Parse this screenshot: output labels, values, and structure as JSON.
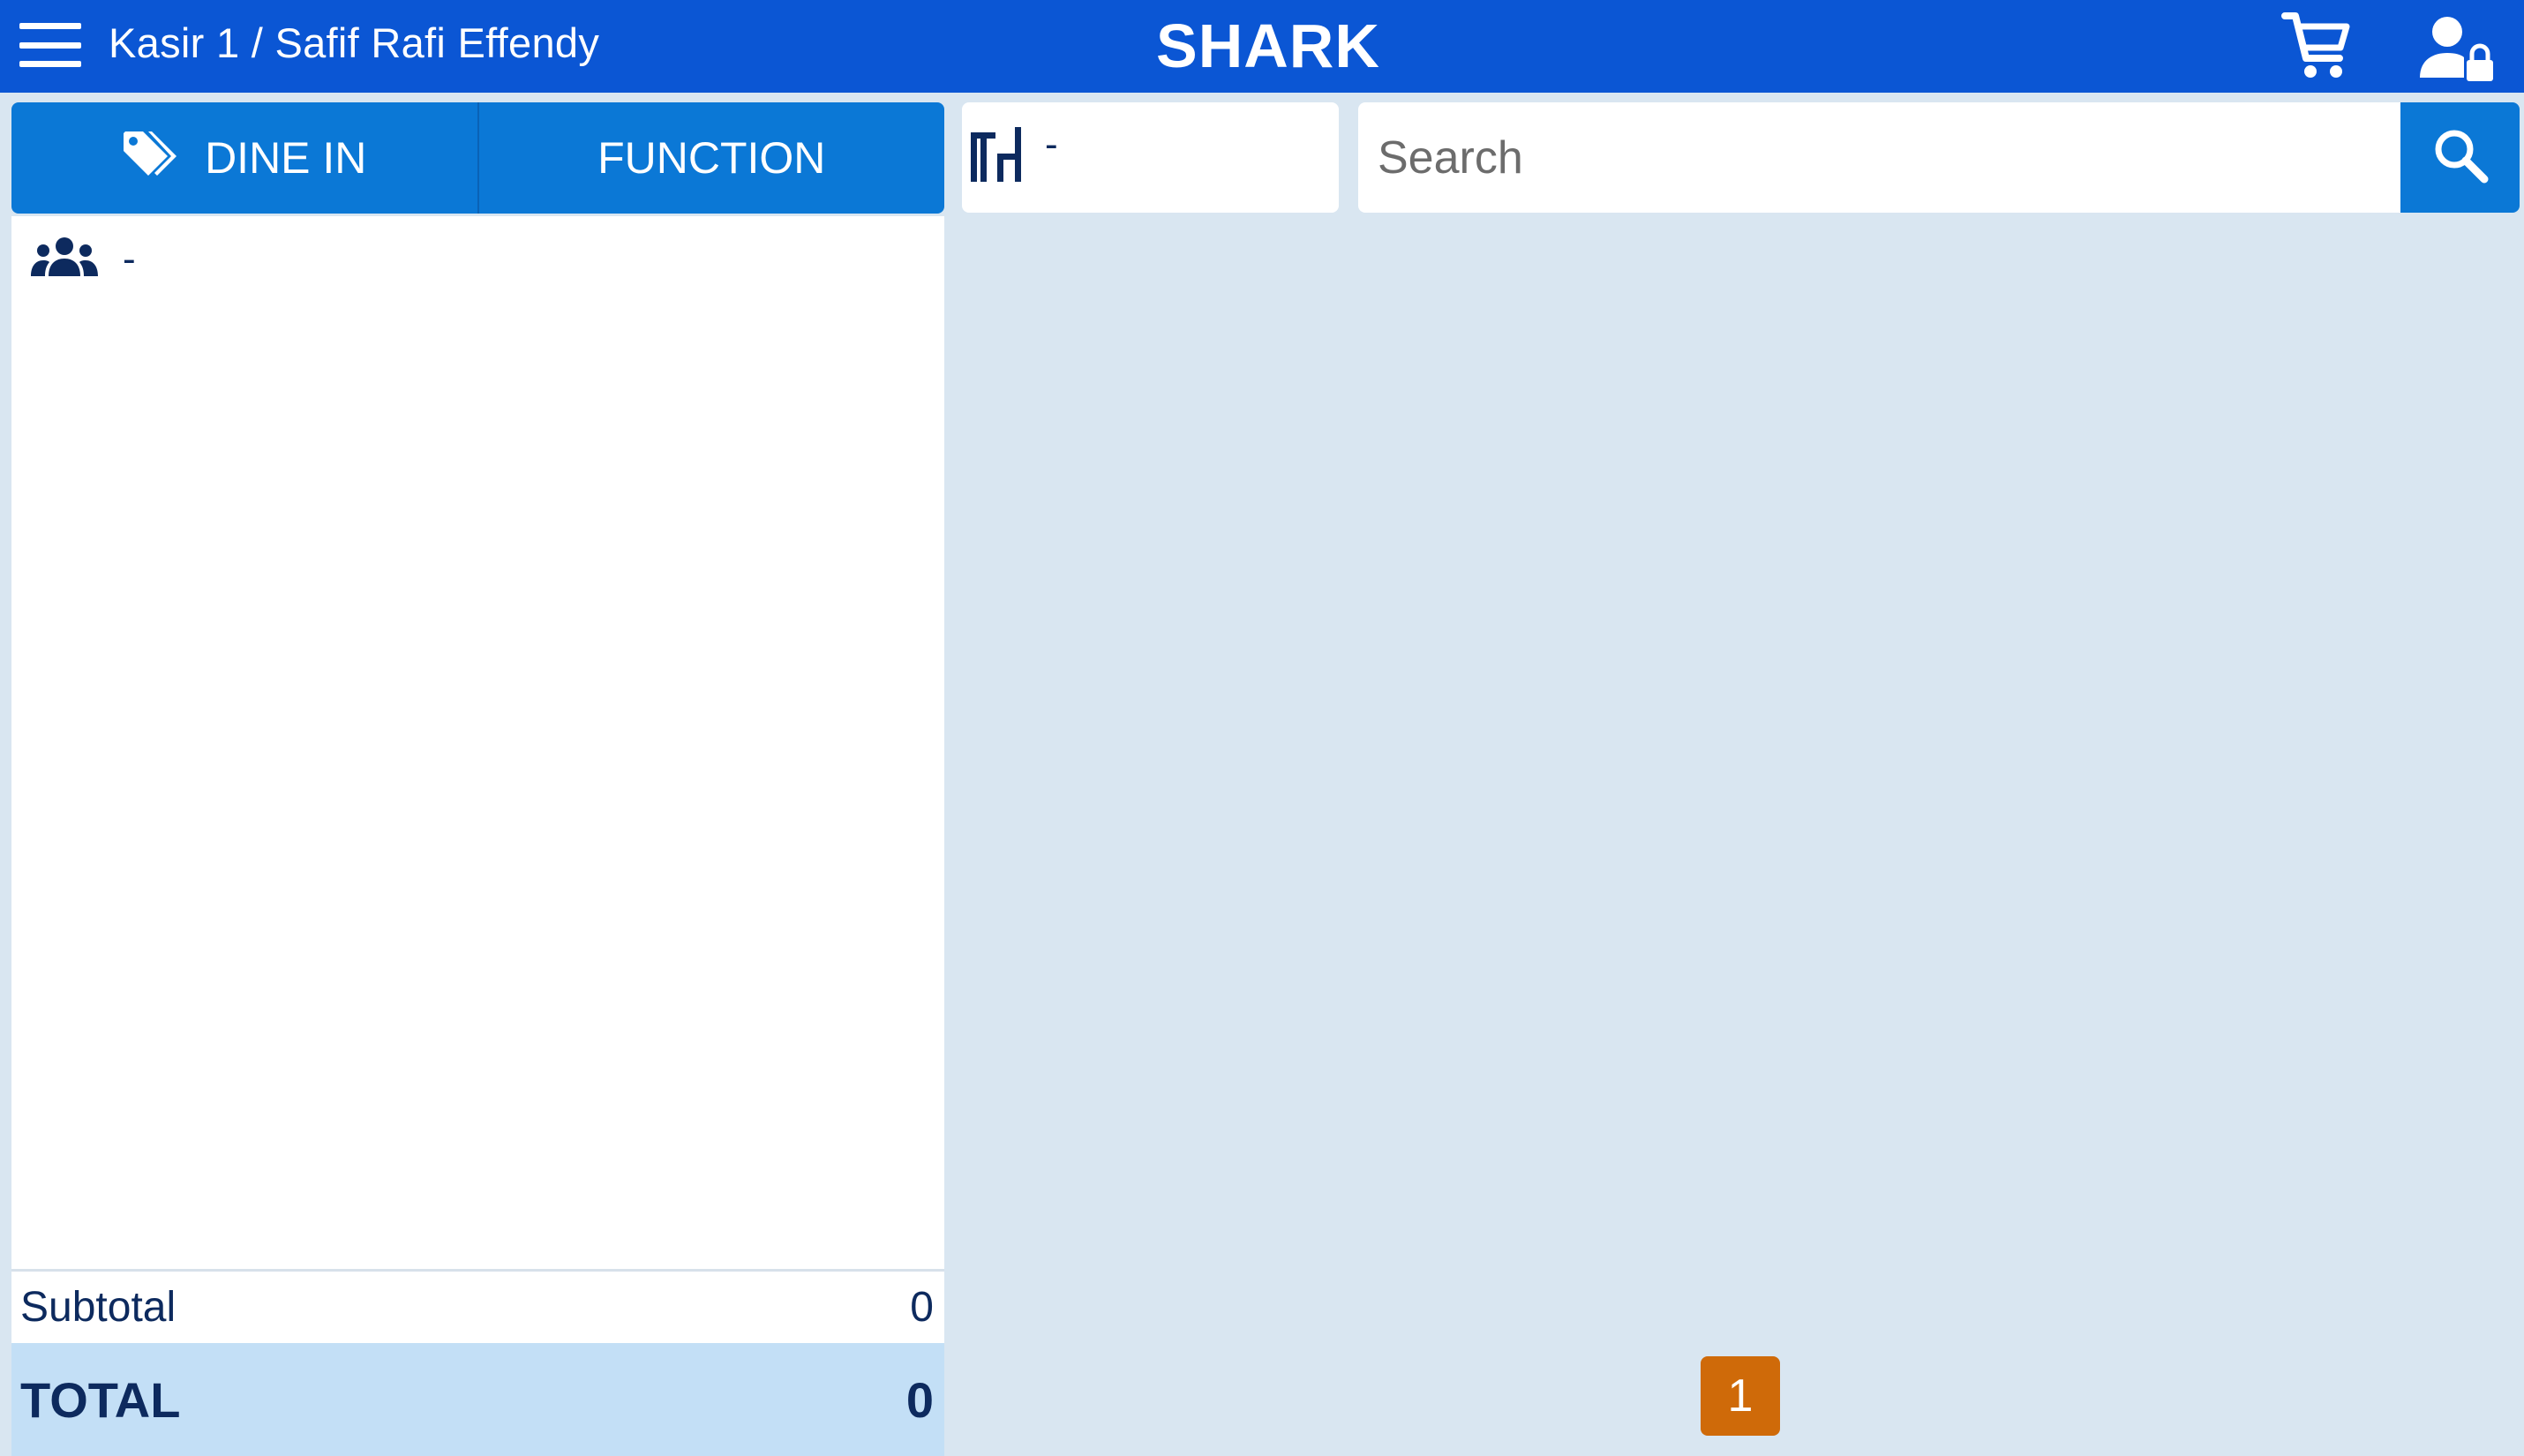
{
  "header": {
    "breadcrumb": "Kasir 1 / Safif Rafi Effendy",
    "brand": "SHARK",
    "icons": [
      "menu-icon",
      "cart-icon",
      "user-lock-icon"
    ]
  },
  "order": {
    "tabs": [
      {
        "label": "DINE IN",
        "icon": "tag-icon"
      },
      {
        "label": "FUNCTION"
      }
    ],
    "guests": {
      "icon": "users-icon",
      "value": "-"
    },
    "subtotal": {
      "label": "Subtotal",
      "value": "0"
    },
    "total": {
      "label": "TOTAL",
      "value": "0"
    }
  },
  "table": {
    "icon": "table-icon",
    "value": "-"
  },
  "search": {
    "placeholder": "Search",
    "icon": "search-icon"
  },
  "pagination": {
    "current_page": "1"
  },
  "colors": {
    "header": "#0b56d4",
    "accent": "#0b78d6",
    "background": "#d9e6f1",
    "total_bg": "#c3dff6",
    "text_dark": "#0d2a5e",
    "page_button": "#cf6a09"
  }
}
